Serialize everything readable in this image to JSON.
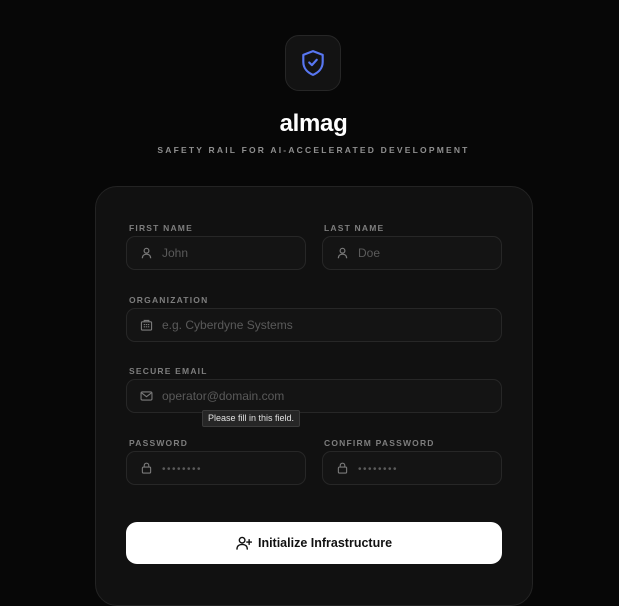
{
  "brand": {
    "name": "almag",
    "tagline": "SAFETY RAIL FOR AI-ACCELERATED DEVELOPMENT",
    "logo_icon": "shield-check-icon",
    "accent_color": "#4f6ef0"
  },
  "form": {
    "first_name": {
      "label": "FIRST NAME",
      "placeholder": "John",
      "icon": "user-icon"
    },
    "last_name": {
      "label": "LAST NAME",
      "placeholder": "Doe",
      "icon": "user-icon"
    },
    "organization": {
      "label": "ORGANIZATION",
      "placeholder": "e.g. Cyberdyne Systems",
      "icon": "building-icon"
    },
    "email": {
      "label": "SECURE EMAIL",
      "placeholder": "operator@domain.com",
      "icon": "mail-icon"
    },
    "password": {
      "label": "PASSWORD",
      "placeholder": "••••••••",
      "icon": "lock-icon"
    },
    "confirm_password": {
      "label": "CONFIRM PASSWORD",
      "placeholder": "••••••••",
      "icon": "lock-icon"
    },
    "validation_tooltip": "Please fill in this field.",
    "submit": {
      "label": "Initialize Infrastructure",
      "icon": "user-plus-icon"
    }
  }
}
